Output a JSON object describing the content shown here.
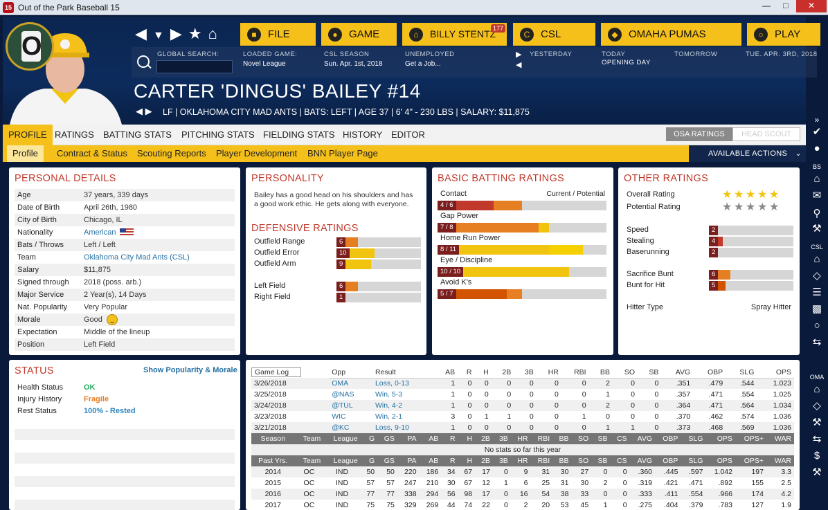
{
  "window": {
    "title": "Out of the Park Baseball 15",
    "app_icon": "15"
  },
  "topnav": {
    "buttons": [
      {
        "label": "FILE",
        "icon": "file-icon"
      },
      {
        "label": "GAME",
        "icon": "globe-icon"
      },
      {
        "label": "BILLY STENTZ",
        "icon": "home-icon",
        "badge": "177"
      },
      {
        "label": "CSL",
        "icon": "csl-logo-icon"
      },
      {
        "label": "OMAHA PUMAS",
        "icon": "team-logo-icon"
      },
      {
        "label": "PLAY",
        "icon": "baseball-icon"
      }
    ]
  },
  "infobar": {
    "global_search_label": "GLOBAL SEARCH:",
    "loaded_game_label": "LOADED GAME:",
    "loaded_game_value": "Novel League",
    "csl_season_label": "CSL SEASON",
    "csl_season_value": "Sun. Apr. 1st, 2018",
    "unemployed_label": "UNEMPLOYED",
    "unemployed_value": "Get a Job...",
    "yesterday_label": "YESTERDAY",
    "today_label": "TODAY",
    "today_value": "OPENING DAY",
    "tomorrow_label": "TOMORROW",
    "date_label": "TUE. APR. 3RD, 2018"
  },
  "player": {
    "name": "CARTER 'DINGUS' BAILEY  #14",
    "line": "LF | OKLAHOMA CITY MAD ANTS | BATS: LEFT | AGE 37 | 6' 4\" - 230 LBS | SALARY: $11,875",
    "team_logo_letter": "O"
  },
  "tabs": [
    "PROFILE",
    "RATINGS",
    "BATTING STATS",
    "PITCHING STATS",
    "FIELDING STATS",
    "HISTORY",
    "EDITOR"
  ],
  "rating_toggle": {
    "osa": "OSA RATINGS",
    "scout": "HEAD SCOUT"
  },
  "subtabs": [
    "Profile",
    "Contract & Status",
    "Scouting Reports",
    "Player Development",
    "BNN Player Page"
  ],
  "available_actions": "AVAILABLE ACTIONS",
  "sidebar": {
    "labels": [
      "BS",
      "CSL",
      "OMA"
    ],
    "badge": "177"
  },
  "personal": {
    "title": "PERSONAL DETAILS",
    "rows": [
      {
        "k": "Age",
        "v": "37 years, 339 days"
      },
      {
        "k": "Date of Birth",
        "v": "April 26th, 1980"
      },
      {
        "k": "City of Birth",
        "v": "Chicago, IL"
      },
      {
        "k": "Nationality",
        "v": "American"
      },
      {
        "k": "Bats / Throws",
        "v": "Left / Left"
      },
      {
        "k": "Team",
        "v": "Oklahoma City Mad Ants (CSL)"
      },
      {
        "k": "Salary",
        "v": "$11,875"
      },
      {
        "k": "Signed through",
        "v": "2018 (poss. arb.)"
      },
      {
        "k": "Major Service",
        "v": "2 Year(s), 14 Days"
      },
      {
        "k": "Nat. Popularity",
        "v": "Very Popular"
      },
      {
        "k": "Morale",
        "v": "Good"
      },
      {
        "k": "Expectation",
        "v": "Middle of the lineup"
      },
      {
        "k": "Position",
        "v": "Left Field"
      }
    ]
  },
  "personality": {
    "title": "PERSONALITY",
    "text": "Bailey has a good head on his shoulders and has a good work ethic. He gets along with everyone."
  },
  "defensive": {
    "title": "DEFENSIVE RATINGS",
    "rows": [
      {
        "label": "Outfield Range",
        "value": "6",
        "pct": 0.25,
        "color": "#e67e22"
      },
      {
        "label": "Outfield Error",
        "value": "10",
        "pct": 0.45,
        "color": "#f1c40f"
      },
      {
        "label": "Outfield Arm",
        "value": "9",
        "pct": 0.41,
        "color": "#f1c40f"
      },
      {
        "label": "Left Field",
        "value": "6",
        "pct": 0.25,
        "color": "#e67e22"
      },
      {
        "label": "Right Field",
        "value": "1",
        "pct": 0.08,
        "color": "#c0392b"
      }
    ]
  },
  "batting": {
    "title": "BASIC BATTING RATINGS",
    "col1": "Contact",
    "col2": "Current / Potential",
    "rows": [
      {
        "label": "Contact",
        "value": "4 / 6",
        "cur": 0.33,
        "pot": 0.5,
        "curColor": "#c0392b",
        "potColor": "#e67e22"
      },
      {
        "label": "Gap Power",
        "value": "7 / 8",
        "cur": 0.6,
        "pot": 0.66,
        "curColor": "#e67e22",
        "potColor": "#f1c40f"
      },
      {
        "label": "Home Run Power",
        "value": "8 / 11",
        "cur": 0.66,
        "pot": 0.86,
        "curColor": "#f1c40f",
        "potColor": "#f5d000"
      },
      {
        "label": "Eye / Discipline",
        "value": "10 / 10",
        "cur": 0.78,
        "pot": 0.78,
        "curColor": "#f1c40f",
        "potColor": "#f1c40f"
      },
      {
        "label": "Avoid K's",
        "value": "5 / 7",
        "cur": 0.41,
        "pot": 0.5,
        "curColor": "#d35400",
        "potColor": "#e67e22"
      }
    ]
  },
  "other": {
    "title": "OTHER RATINGS",
    "overall_label": "Overall Rating",
    "overall_stars": 5,
    "potential_label": "Potential Rating",
    "potential_stars": 5,
    "rows": [
      {
        "label": "Speed",
        "value": "2",
        "pct": 0.08,
        "color": "#c0392b"
      },
      {
        "label": "Stealing",
        "value": "4",
        "pct": 0.16,
        "color": "#c0392b"
      },
      {
        "label": "Baserunning",
        "value": "2",
        "pct": 0.08,
        "color": "#c0392b"
      },
      {
        "label": "Sacrifice Bunt",
        "value": "6",
        "pct": 0.25,
        "color": "#e67e22"
      },
      {
        "label": "Bunt for Hit",
        "value": "5",
        "pct": 0.2,
        "color": "#d35400"
      }
    ],
    "hitter_type_label": "Hitter Type",
    "hitter_type_value": "Spray Hitter"
  },
  "status": {
    "title": "STATUS",
    "link": "Show Popularity & Morale",
    "rows": [
      {
        "k": "Health Status",
        "v": "OK",
        "color": "#27ae60"
      },
      {
        "k": "Injury History",
        "v": "Fragile",
        "color": "#e67e22"
      },
      {
        "k": "Rest Status",
        "v": "100% - Rested",
        "color": "#2e86c1"
      }
    ]
  },
  "gamelog": {
    "dropdown": "Game Log",
    "headers": [
      "Opp",
      "Result",
      "AB",
      "R",
      "H",
      "2B",
      "3B",
      "HR",
      "RBI",
      "BB",
      "SO",
      "SB",
      "AVG",
      "OBP",
      "SLG",
      "OPS"
    ],
    "rows": [
      [
        "3/26/2018",
        "OMA",
        "Loss, 0-13",
        "1",
        "0",
        "0",
        "0",
        "0",
        "0",
        "0",
        "2",
        "0",
        "0",
        ".351",
        ".479",
        ".544",
        "1.023"
      ],
      [
        "3/25/2018",
        "@NAS",
        "Win, 5-3",
        "1",
        "0",
        "0",
        "0",
        "0",
        "0",
        "0",
        "1",
        "0",
        "0",
        ".357",
        ".471",
        ".554",
        "1.025"
      ],
      [
        "3/24/2018",
        "@TUL",
        "Win, 4-2",
        "1",
        "0",
        "0",
        "0",
        "0",
        "0",
        "0",
        "2",
        "0",
        "0",
        ".364",
        ".471",
        ".564",
        "1.034"
      ],
      [
        "3/23/2018",
        "WIC",
        "Win, 2-1",
        "3",
        "0",
        "1",
        "1",
        "0",
        "0",
        "1",
        "0",
        "0",
        "0",
        ".370",
        ".462",
        ".574",
        "1.036"
      ],
      [
        "3/21/2018",
        "@KC",
        "Loss, 9-10",
        "1",
        "0",
        "0",
        "0",
        "0",
        "0",
        "0",
        "1",
        "1",
        "0",
        ".373",
        ".468",
        ".569",
        "1.036"
      ]
    ],
    "season_headers": [
      "Season",
      "Team",
      "League",
      "G",
      "GS",
      "PA",
      "AB",
      "R",
      "H",
      "2B",
      "3B",
      "HR",
      "RBI",
      "BB",
      "SO",
      "SB",
      "CS",
      "AVG",
      "OBP",
      "SLG",
      "OPS",
      "OPS+",
      "WAR"
    ],
    "no_stats": "No stats so far this year",
    "past_headers": [
      "Past Yrs.",
      "Team",
      "League",
      "G",
      "GS",
      "PA",
      "AB",
      "R",
      "H",
      "2B",
      "3B",
      "HR",
      "RBI",
      "BB",
      "SO",
      "SB",
      "CS",
      "AVG",
      "OBP",
      "SLG",
      "OPS",
      "OPS+",
      "WAR"
    ],
    "past_rows": [
      [
        "2014",
        "OC",
        "IND",
        "50",
        "50",
        "220",
        "186",
        "34",
        "67",
        "17",
        "0",
        "9",
        "31",
        "30",
        "27",
        "0",
        "0",
        ".360",
        ".445",
        ".597",
        "1.042",
        "197",
        "3.3"
      ],
      [
        "2015",
        "OC",
        "IND",
        "57",
        "57",
        "247",
        "210",
        "30",
        "67",
        "12",
        "1",
        "6",
        "25",
        "31",
        "30",
        "2",
        "0",
        ".319",
        ".421",
        ".471",
        ".892",
        "155",
        "2.5"
      ],
      [
        "2016",
        "OC",
        "IND",
        "77",
        "77",
        "338",
        "294",
        "56",
        "98",
        "17",
        "0",
        "16",
        "54",
        "38",
        "33",
        "0",
        "0",
        ".333",
        ".411",
        ".554",
        ".966",
        "174",
        "4.2"
      ],
      [
        "2017",
        "OC",
        "IND",
        "75",
        "75",
        "329",
        "269",
        "44",
        "74",
        "22",
        "0",
        "2",
        "20",
        "53",
        "45",
        "1",
        "0",
        ".275",
        ".404",
        ".379",
        ".783",
        "127",
        "1.9"
      ]
    ]
  }
}
